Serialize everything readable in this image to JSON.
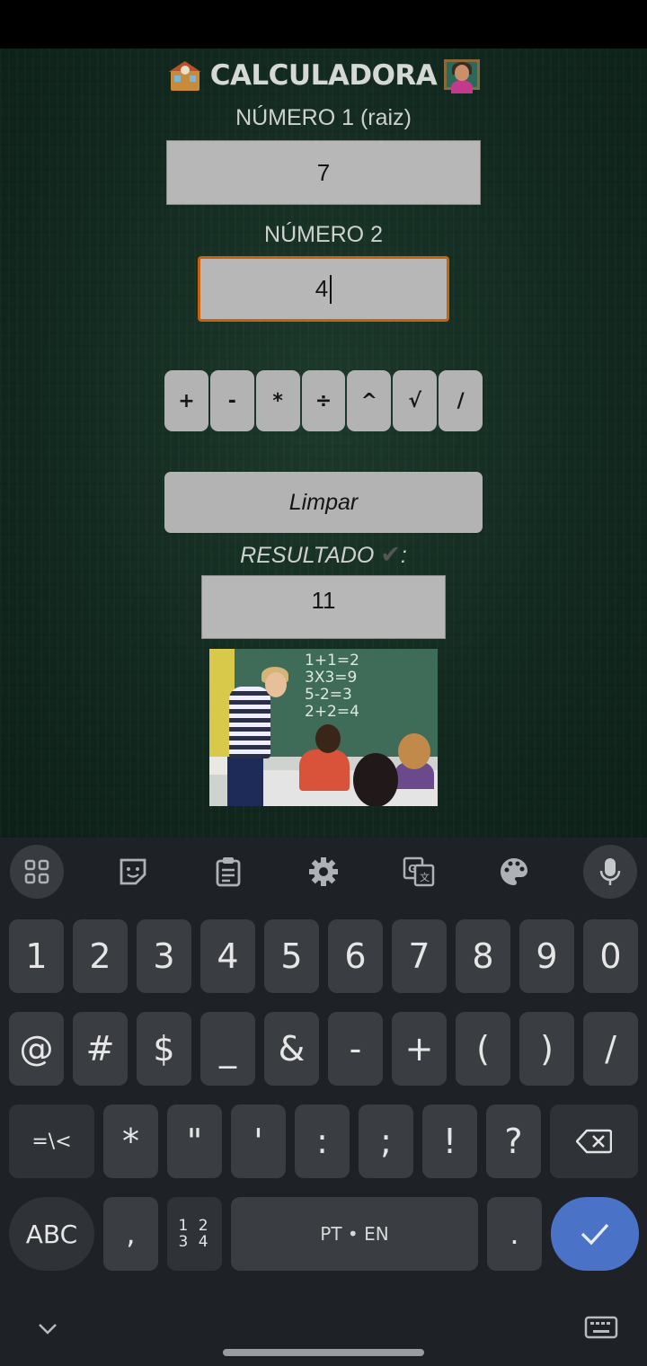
{
  "app": {
    "title": "CALCULADORA",
    "label_num1": "NÚMERO 1 (raiz)",
    "value_num1": "7",
    "label_num2": "NÚMERO 2",
    "value_num2": "4",
    "operators": [
      "+",
      "-",
      "*",
      "÷",
      "^",
      "√",
      "/"
    ],
    "clear_label": "Limpar",
    "result_label": "RESULTADO",
    "result_check": "✔",
    "result_colon": ":",
    "result_value": "11",
    "photo_math": [
      "1+1=2",
      "3X3=9",
      "5-2=3",
      "2+2=4"
    ],
    "icons": [
      "school-icon",
      "teacher-icon",
      "classroom-photo"
    ]
  },
  "keyboard": {
    "toolbar_icons": [
      "apps-grid-icon",
      "sticker-icon",
      "clipboard-icon",
      "settings-gear-icon",
      "translate-icon",
      "palette-icon",
      "microphone-icon"
    ],
    "row1": [
      "1",
      "2",
      "3",
      "4",
      "5",
      "6",
      "7",
      "8",
      "9",
      "0"
    ],
    "row2": [
      "@",
      "#",
      "$",
      "_",
      "&",
      "-",
      "+",
      "(",
      ")",
      "/"
    ],
    "row3": [
      "=\\<",
      "*",
      "\"",
      "'",
      ":",
      ";",
      "!",
      "?"
    ],
    "abc": "ABC",
    "comma": ",",
    "numpad": "1 2\n3 4",
    "space": "PT • EN",
    "period": ".",
    "colors": {
      "accent": "#4a72c7",
      "key": "#3a3e43",
      "bg": "#1e2125"
    }
  }
}
